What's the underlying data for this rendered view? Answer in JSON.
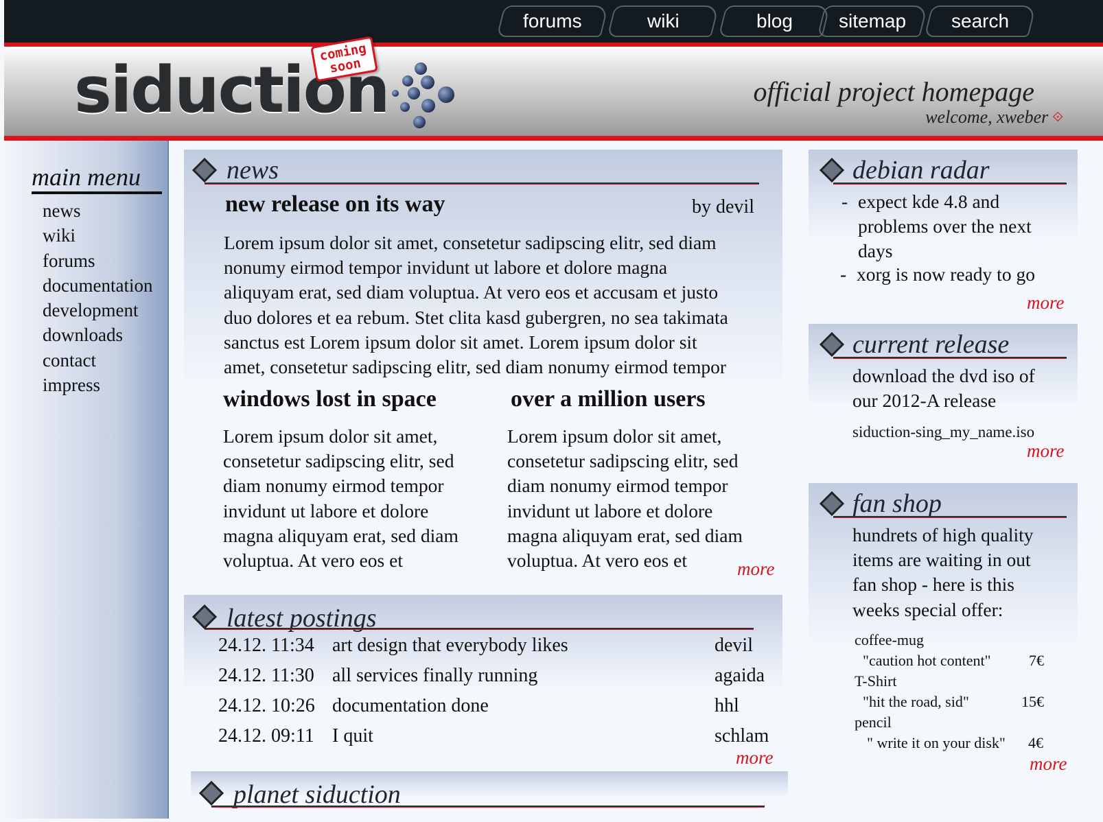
{
  "nav": [
    "forums",
    "wiki",
    "blog",
    "sitemap",
    "search"
  ],
  "header": {
    "logo": "siduction",
    "badge_line1": "coming",
    "badge_line2": "soon",
    "tagline": "official project homepage",
    "welcome": "welcome, xweber"
  },
  "sidebar": {
    "title": "main menu",
    "items": [
      "news",
      "wiki",
      "forums",
      "documentation",
      "development",
      "downloads",
      "contact",
      "impress"
    ]
  },
  "news": {
    "title": "news",
    "main_headline": "new release on its way",
    "main_author": "by devil",
    "main_text": [
      "Lorem ipsum dolor sit amet, consetetur sadipscing elitr, sed diam",
      "nonumy eirmod tempor invidunt ut labore et dolore magna",
      "aliquyam erat, sed diam voluptua. At vero eos et accusam et justo",
      "duo dolores et ea rebum. Stet clita kasd gubergren, no sea takimata",
      "sanctus est Lorem ipsum dolor sit amet. Lorem ipsum dolor sit",
      "amet, consetetur sadipscing elitr, sed diam nonumy eirmod tempor"
    ],
    "left_headline": "windows lost in space",
    "left_text": [
      "Lorem ipsum dolor sit amet,",
      "consetetur sadipscing elitr, sed",
      "diam nonumy eirmod tempor",
      "invidunt ut labore et dolore",
      "magna aliquyam erat, sed diam",
      "voluptua. At vero eos et"
    ],
    "right_headline": "over a million users",
    "right_text": [
      "Lorem ipsum dolor sit amet,",
      "consetetur sadipscing elitr, sed",
      "diam nonumy eirmod tempor",
      "invidunt ut labore et dolore",
      "magna aliquyam erat, sed diam",
      "voluptua. At vero eos et"
    ],
    "more": "more"
  },
  "postings": {
    "title": "latest postings",
    "rows": [
      {
        "time": "24.12. 11:34",
        "subject": "art design that everybody likes",
        "author": "devil"
      },
      {
        "time": "24.12. 11:30",
        "subject": "all services finally running",
        "author": "agaida"
      },
      {
        "time": "24.12. 10:26",
        "subject": "documentation done",
        "author": "hhl"
      },
      {
        "time": "24.12. 09:11",
        "subject": "I quit",
        "author": "schlam"
      }
    ],
    "more": "more"
  },
  "planet": {
    "title": "planet siduction"
  },
  "radar": {
    "title": "debian radar",
    "items": [
      [
        "expect kde 4.8 and",
        "problems over the next",
        "days"
      ],
      [
        "xorg is now ready to go"
      ]
    ],
    "bullet": "-",
    "more": "more"
  },
  "release": {
    "title": "current release",
    "text": [
      "download the dvd iso of",
      "our 2012-A release"
    ],
    "file": "siduction-sing_my_name.iso",
    "more": "more"
  },
  "shop": {
    "title": "fan shop",
    "text": [
      "hundrets of high quality",
      "items are waiting in out",
      "fan shop - here is this",
      "weeks special offer:"
    ],
    "items": [
      {
        "name": "coffee-mug",
        "quote": "\"caution hot content\"",
        "price": "7€"
      },
      {
        "name": "T-Shirt",
        "quote": "\"hit the road, sid\"",
        "price": "15€"
      },
      {
        "name": "pencil",
        "quote": "\" write it on your disk\"",
        "price": "4€"
      }
    ],
    "more": "more"
  },
  "colors": {
    "accent": "#d8141c",
    "topbar": "#141b20",
    "panel": "#c2cce0"
  }
}
